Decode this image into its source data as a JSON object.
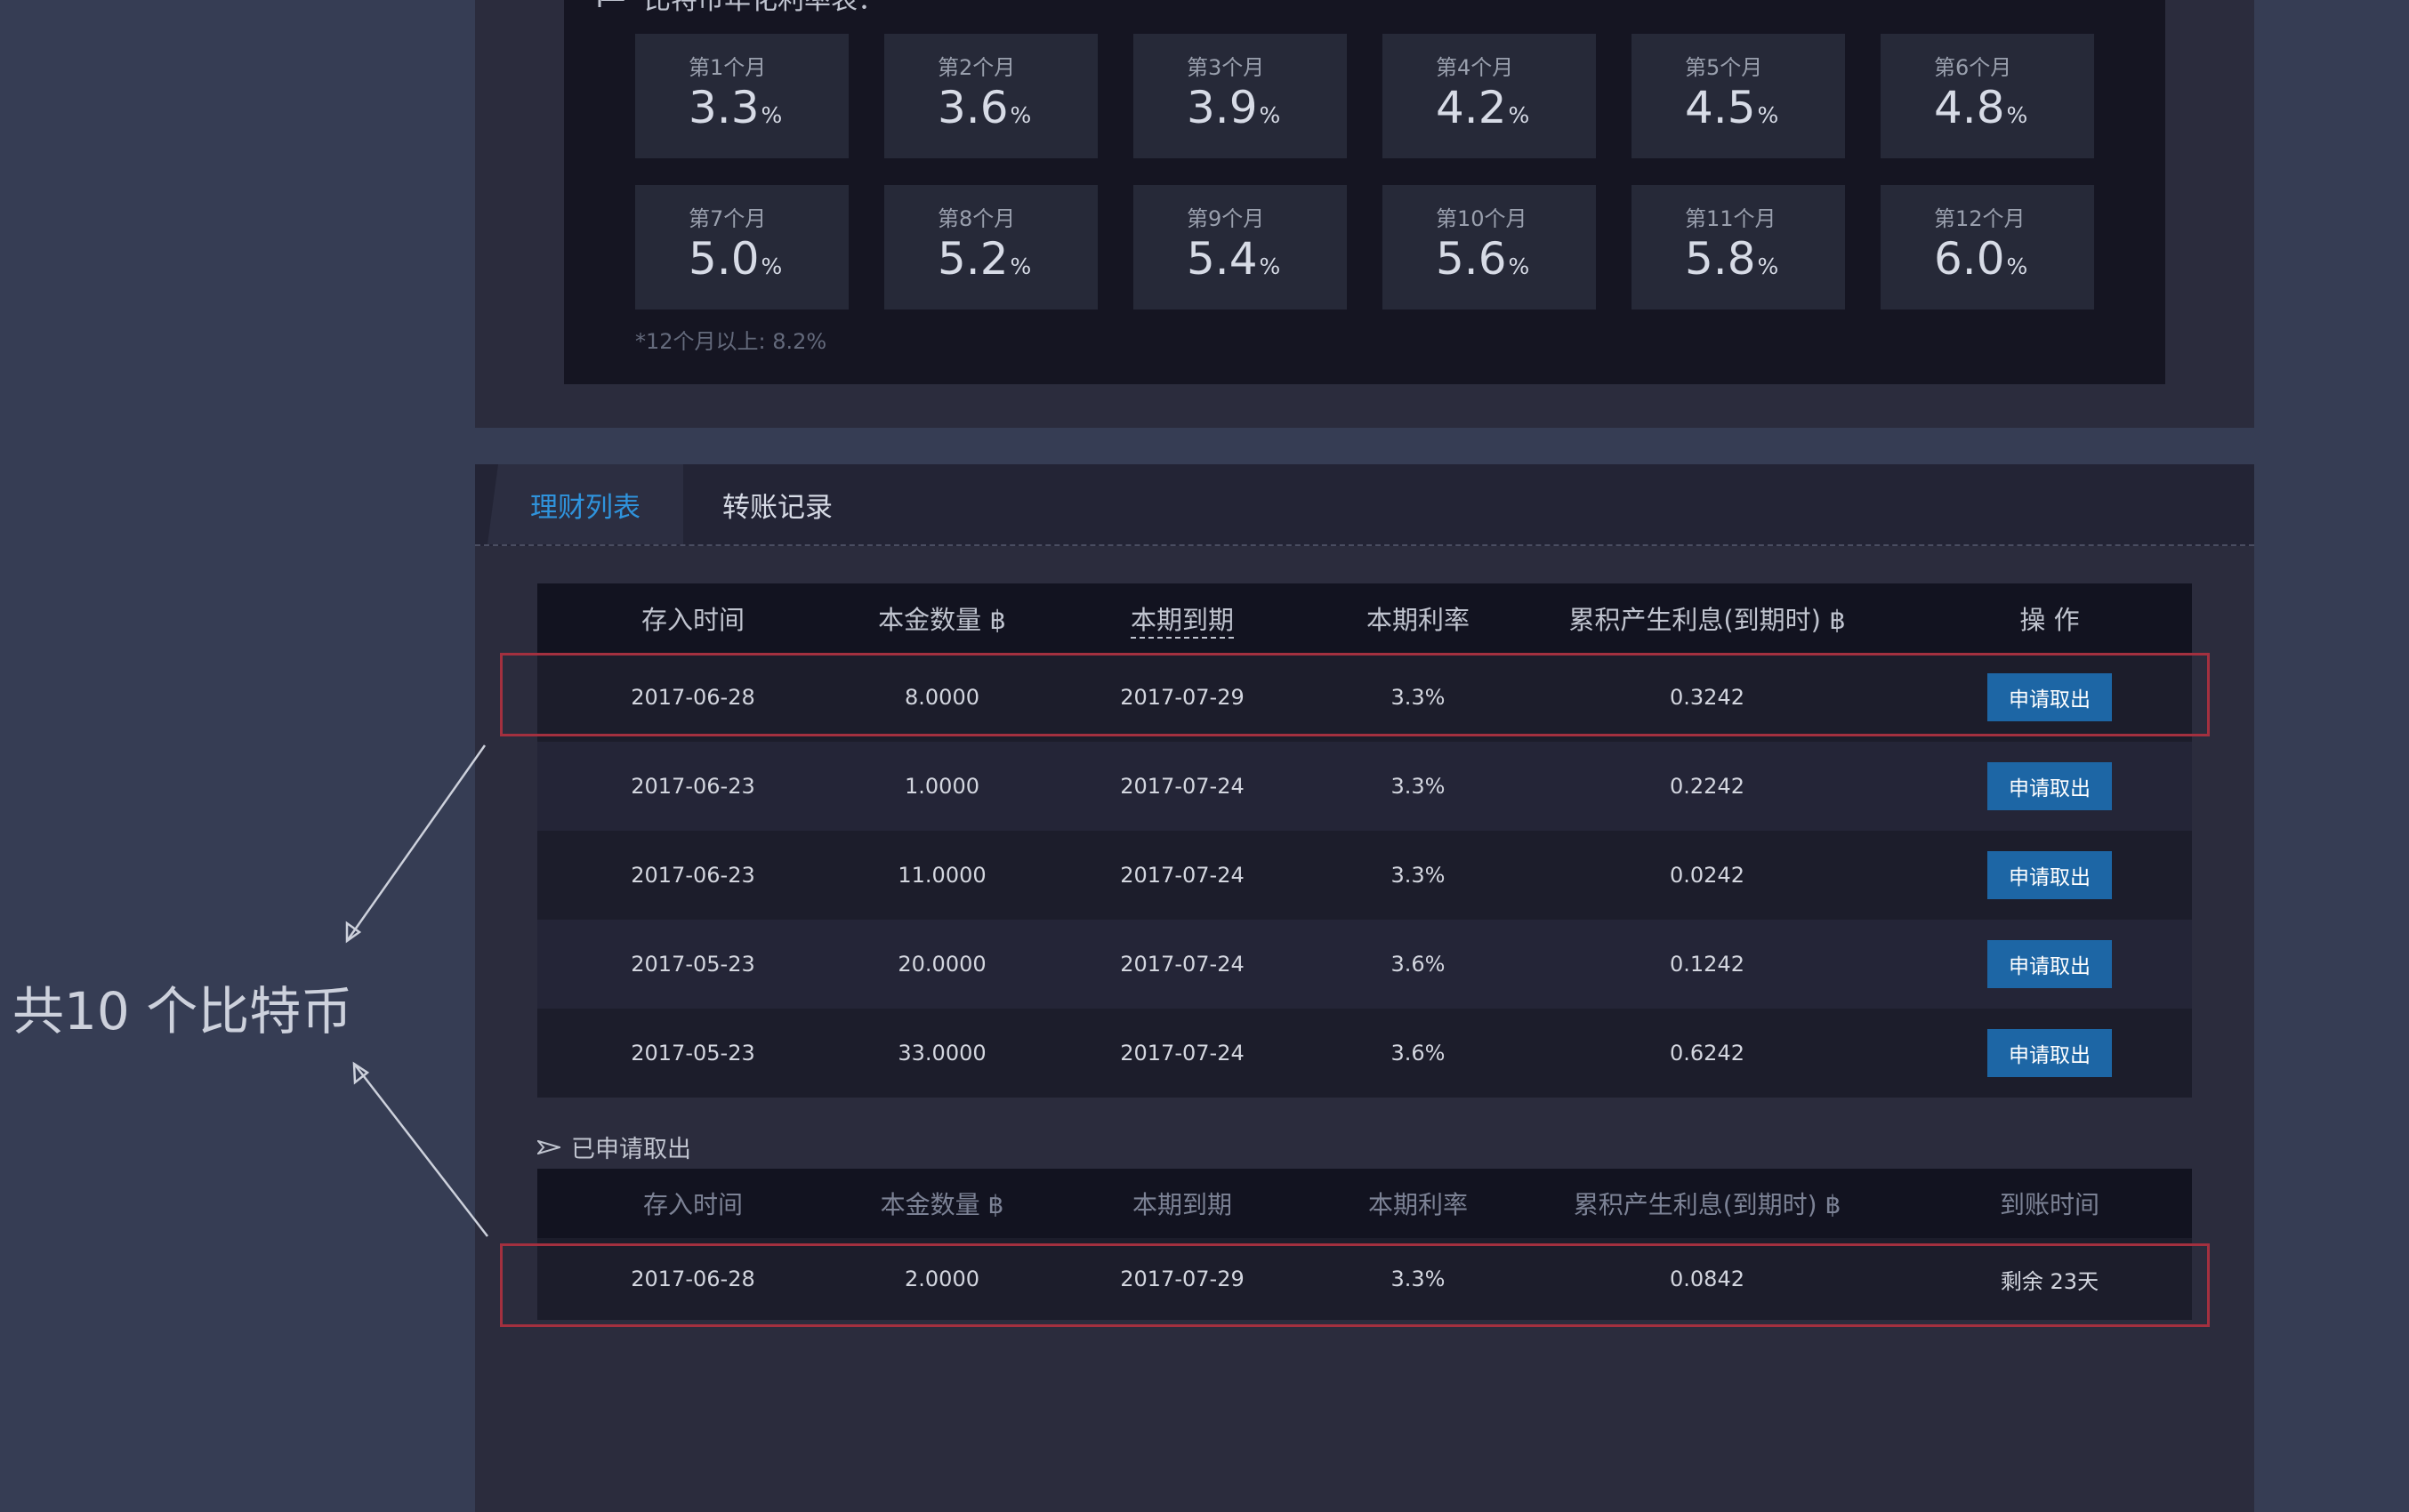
{
  "rate_table": {
    "title": "比特币年化利率表：",
    "cells": [
      {
        "label": "第1个月",
        "value": "3.3",
        "unit": "%"
      },
      {
        "label": "第2个月",
        "value": "3.6",
        "unit": "%"
      },
      {
        "label": "第3个月",
        "value": "3.9",
        "unit": "%"
      },
      {
        "label": "第4个月",
        "value": "4.2",
        "unit": "%"
      },
      {
        "label": "第5个月",
        "value": "4.5",
        "unit": "%"
      },
      {
        "label": "第6个月",
        "value": "4.8",
        "unit": "%"
      },
      {
        "label": "第7个月",
        "value": "5.0",
        "unit": "%"
      },
      {
        "label": "第8个月",
        "value": "5.2",
        "unit": "%"
      },
      {
        "label": "第9个月",
        "value": "5.4",
        "unit": "%"
      },
      {
        "label": "第10个月",
        "value": "5.6",
        "unit": "%"
      },
      {
        "label": "第11个月",
        "value": "5.8",
        "unit": "%"
      },
      {
        "label": "第12个月",
        "value": "6.0",
        "unit": "%"
      }
    ],
    "note": "*12个月以上: 8.2%"
  },
  "tabs": [
    {
      "label": "理财列表",
      "active": true
    },
    {
      "label": "转账记录",
      "active": false
    }
  ],
  "finance_table": {
    "headers": [
      "存入时间",
      "本金数量 ฿",
      "本期到期",
      "本期利率",
      "累积产生利息(到期时) ฿",
      "操 作"
    ],
    "rows": [
      {
        "date": "2017-06-28",
        "amount": "8.0000",
        "due": "2017-07-29",
        "rate": "3.3%",
        "interest": "0.3242",
        "action": "申请取出"
      },
      {
        "date": "2017-06-23",
        "amount": "1.0000",
        "due": "2017-07-24",
        "rate": "3.3%",
        "interest": "0.2242",
        "action": "申请取出"
      },
      {
        "date": "2017-06-23",
        "amount": "11.0000",
        "due": "2017-07-24",
        "rate": "3.3%",
        "interest": "0.0242",
        "action": "申请取出"
      },
      {
        "date": "2017-05-23",
        "amount": "20.0000",
        "due": "2017-07-24",
        "rate": "3.6%",
        "interest": "0.1242",
        "action": "申请取出"
      },
      {
        "date": "2017-05-23",
        "amount": "33.0000",
        "due": "2017-07-24",
        "rate": "3.6%",
        "interest": "0.6242",
        "action": "申请取出"
      }
    ]
  },
  "withdrawn_section": {
    "label": "已申请取出",
    "headers": [
      "存入时间",
      "本金数量 ฿",
      "本期到期",
      "本期利率",
      "累积产生利息(到期时) ฿",
      "到账时间"
    ],
    "rows": [
      {
        "date": "2017-06-28",
        "amount": "2.0000",
        "due": "2017-07-29",
        "rate": "3.3%",
        "interest": "0.0842",
        "arrival": "剩余 23天"
      }
    ]
  },
  "annotation": {
    "text": "共10 个比特币"
  },
  "colors": {
    "page_bg": "#363d54",
    "panel_bg": "#2b2c3d",
    "accent": "#2f93dc",
    "button": "#1d66a5",
    "highlight": "#a3303f"
  }
}
